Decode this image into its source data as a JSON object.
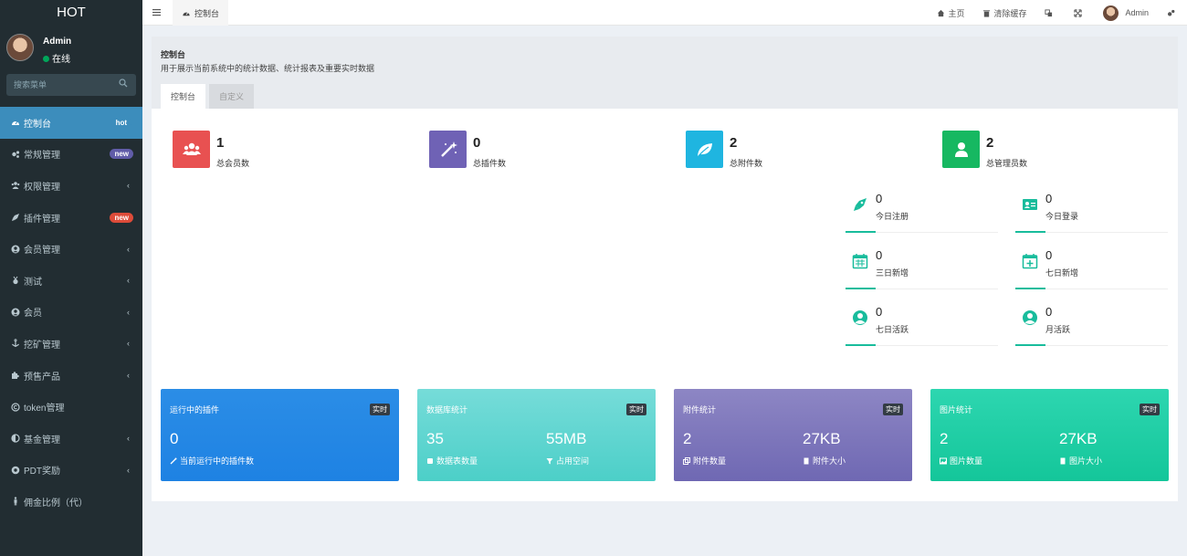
{
  "app": {
    "logo": "HOT"
  },
  "user": {
    "name": "Admin",
    "status": "在线"
  },
  "search": {
    "placeholder": "搜索菜单"
  },
  "menu": [
    {
      "label": "控制台",
      "badge": "hot",
      "icon": "dashboard-icon"
    },
    {
      "label": "常规管理",
      "badge": "new",
      "icon": "cogs-icon"
    },
    {
      "label": "权限管理",
      "icon": "users-icon",
      "chevron": "‹"
    },
    {
      "label": "插件管理",
      "badge": "new",
      "icon": "rocket-icon"
    },
    {
      "label": "会员管理",
      "icon": "user-circle-icon",
      "chevron": "‹"
    },
    {
      "label": "测试",
      "icon": "medal-icon",
      "chevron": "‹"
    },
    {
      "label": "会员",
      "icon": "user-circle-icon",
      "chevron": "‹"
    },
    {
      "label": "挖矿管理",
      "icon": "anchor-icon",
      "chevron": "‹"
    },
    {
      "label": "预售产品",
      "icon": "puzzle-icon",
      "chevron": "‹"
    },
    {
      "label": "token管理",
      "icon": "copyright-icon"
    },
    {
      "label": "基金管理",
      "icon": "adjust-icon",
      "chevron": "‹"
    },
    {
      "label": "PDT奖励",
      "icon": "chrome-icon",
      "chevron": "‹"
    },
    {
      "label": "佣金比例（代）",
      "icon": "male-icon"
    }
  ],
  "navbar": {
    "tab": "控制台",
    "home": "主页",
    "clear_cache": "清除缓存",
    "admin": "Admin"
  },
  "page": {
    "title": "控制台",
    "description": "用于展示当前系统中的统计数据、统计报表及重要实时数据",
    "tabs": [
      "控制台",
      "自定义"
    ]
  },
  "stats": [
    {
      "value": "1",
      "label": "总会员数",
      "color": "#dd4b39",
      "icon": "users-icon"
    },
    {
      "value": "0",
      "label": "总插件数",
      "color": "#605ca8",
      "icon": "magic-icon"
    },
    {
      "value": "2",
      "label": "总附件数",
      "color": "#00c0ef",
      "icon": "leaf-icon"
    },
    {
      "value": "2",
      "label": "总管理员数",
      "color": "#00a65a",
      "icon": "user-icon"
    }
  ],
  "mini_stats": [
    {
      "value": "0",
      "label": "今日注册",
      "icon": "rocket-icon"
    },
    {
      "value": "0",
      "label": "今日登录",
      "icon": "vcard-icon"
    },
    {
      "value": "0",
      "label": "三日新增",
      "icon": "calendar-icon"
    },
    {
      "value": "0",
      "label": "七日新增",
      "icon": "calendar-plus-icon"
    },
    {
      "value": "0",
      "label": "七日活跃",
      "icon": "user-circle-icon"
    },
    {
      "value": "0",
      "label": "月活跃",
      "icon": "user-circle-icon"
    }
  ],
  "cards": [
    {
      "title": "运行中的插件",
      "tag": "实时",
      "v1": "0",
      "l1": "当前运行中的插件数"
    },
    {
      "title": "数据库统计",
      "tag": "实时",
      "v1": "35",
      "l1": "数据表数量",
      "v2": "55MB",
      "l2": "占用空间"
    },
    {
      "title": "附件统计",
      "tag": "实时",
      "v1": "2",
      "l1": "附件数量",
      "v2": "27KB",
      "l2": "附件大小"
    },
    {
      "title": "图片统计",
      "tag": "实时",
      "v1": "2",
      "l1": "图片数量",
      "v2": "27KB",
      "l2": "图片大小"
    }
  ],
  "colors": {
    "sidebar": "#222d32",
    "active": "#3c8dbc",
    "accent": "#18bc9c"
  }
}
